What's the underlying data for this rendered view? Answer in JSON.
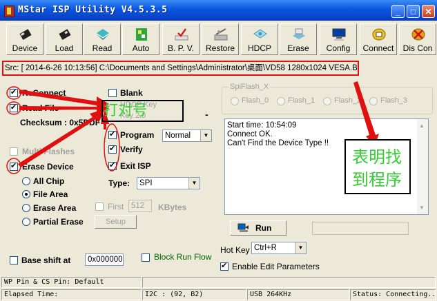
{
  "window": {
    "title": "MStar ISP Utility V4.5.3.5",
    "min": "_",
    "max": "□",
    "close": "✕"
  },
  "toolbar": [
    {
      "label": "Device",
      "icon": "chip-icon"
    },
    {
      "label": "Load",
      "icon": "chip-load-icon"
    },
    {
      "label": "Read",
      "icon": "read-icon"
    },
    {
      "label": "Auto",
      "icon": "auto-icon"
    },
    {
      "label": "B. P. V.",
      "icon": "bpv-icon"
    },
    {
      "label": "Restore",
      "icon": "restore-icon"
    },
    {
      "label": "HDCP",
      "icon": "hdcp-icon"
    },
    {
      "label": "Erase",
      "icon": "erase-icon"
    },
    {
      "label": "Config",
      "icon": "config-icon"
    },
    {
      "label": "Connect",
      "icon": "connect-icon"
    },
    {
      "label": "Dis Con",
      "icon": "disconnect-icon"
    }
  ],
  "src": "Src: [ 2014-6-26 10:13:56]  C:\\Documents and Settings\\Administrator\\桌面\\VD58 1280x1024 VESA.BIN",
  "options": {
    "reconnect": "ReConnect",
    "read_file": "Read File",
    "checksum": "Checksum : 0x5DDF",
    "multi_flashes": "Multi Flashes",
    "erase_device": "Erase Device",
    "all_chip": "All Chip",
    "file_area": "File Area",
    "erase_area": "Erase Area",
    "partial_erase": "Partial Erase",
    "blank": "Blank",
    "hdcp_key": "HDCP Key",
    "key_2": "Key 2.0",
    "program": "Program",
    "verify": "Verify",
    "exit_isp": "Exit ISP",
    "program_mode": "Normal",
    "type_label": "Type:",
    "type_value": "SPI",
    "first": "First",
    "first_value": "512",
    "kbytes": "KBytes",
    "setup": "Setup",
    "base_shift": "Base shift at",
    "base_shift_value": "0x000000",
    "block_run_flow": "Block Run Flow",
    "dash": "-"
  },
  "spiflash": {
    "title": "SpiFlash_X",
    "flashes": [
      "Flash_0",
      "Flash_1",
      "Flash_2",
      "Flash_3"
    ]
  },
  "log": [
    "Start time: 10:54:09",
    "Connect OK.",
    "Can't Find the Device Type !!"
  ],
  "run": {
    "label": "Run"
  },
  "hotkey": {
    "label": "Hot Key",
    "value": "Ctrl+R"
  },
  "enable_edit": "Enable Edit Parameters",
  "annotations": {
    "left": "打对号",
    "right_line1": "表明找",
    "right_line2": "到程序"
  },
  "status": {
    "wp_pin": "WP Pin & CS Pin: Default",
    "elapsed": "Elapsed Time:",
    "i2c": "I2C :  (92, B2)",
    "usb": "USB  264KHz",
    "state": "Status: Connecting..."
  },
  "colors": {
    "annotation_red": "#E01010",
    "annotation_green": "#33CC33",
    "block_run_flow": "#006400"
  }
}
